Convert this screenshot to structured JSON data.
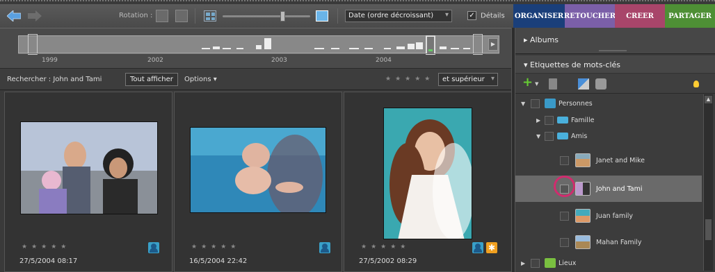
{
  "toolbar": {
    "rotation_label": "Rotation :",
    "sort_select": "Date (ordre décroissant)",
    "details_label": "Détails",
    "details_checked": "✓"
  },
  "tabs": {
    "organiser": "ORGANISER",
    "retoucher": "RETOUCHER",
    "creer": "CREER",
    "partager": "PARTAGER"
  },
  "timeline": {
    "years": [
      "1999",
      "2002",
      "2003",
      "2004"
    ]
  },
  "search": {
    "label": "Rechercher : John and Tami",
    "show_all": "Tout afficher",
    "options": "Options ▾",
    "stars": "★★★★★",
    "rating_filter": "et supérieur"
  },
  "photos": [
    {
      "stars": "★★★★★",
      "date": "27/5/2004 08:17"
    },
    {
      "stars": "★★★★★",
      "date": "16/5/2004 22:42"
    },
    {
      "stars": "★★★★★",
      "date": "27/5/2002 08:29"
    }
  ],
  "panel": {
    "albums": "Albums",
    "keywords": "Etiquettes de mots-clés",
    "tree": {
      "personnes": "Personnes",
      "famille": "Famille",
      "amis": "Amis",
      "janet_mike": "Janet and Mike",
      "john_tami": "John and Tami",
      "juan_family": "Juan family",
      "mahan_family": "Mahan Family",
      "lieux": "Lieux"
    }
  },
  "colors": {
    "tab_organiser": "#1a3f7a",
    "tab_retoucher": "#7b5fa8",
    "tab_creer": "#a8456a",
    "tab_partager": "#4e8f35",
    "highlight": "#d02c6e",
    "person_tag": "#39a0c9"
  }
}
